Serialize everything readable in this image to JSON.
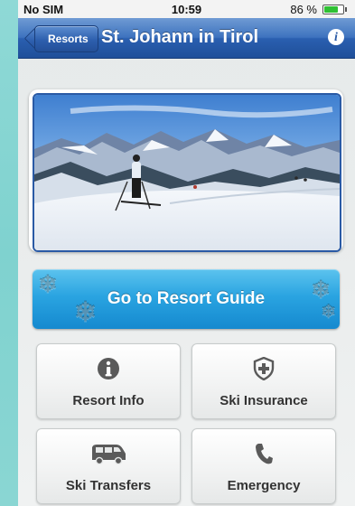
{
  "status_bar": {
    "carrier": "No SIM",
    "time": "10:59",
    "battery_percent": "86 %",
    "battery_level": 0.86
  },
  "nav": {
    "back_label": "Resorts",
    "title": "St. Johann in Tirol",
    "info_label": "i"
  },
  "guide_button": {
    "label": "Go to Resort Guide"
  },
  "tiles": [
    {
      "label": "Resort Info",
      "icon": "info-icon"
    },
    {
      "label": "Ski Insurance",
      "icon": "shield-plus-icon"
    },
    {
      "label": "Ski Transfers",
      "icon": "van-icon"
    },
    {
      "label": "Emergency",
      "icon": "phone-icon"
    }
  ],
  "colors": {
    "nav_blue": "#2a5fb0",
    "guide_blue": "#2aa4e1",
    "icon_gray": "#5a5a5a"
  }
}
